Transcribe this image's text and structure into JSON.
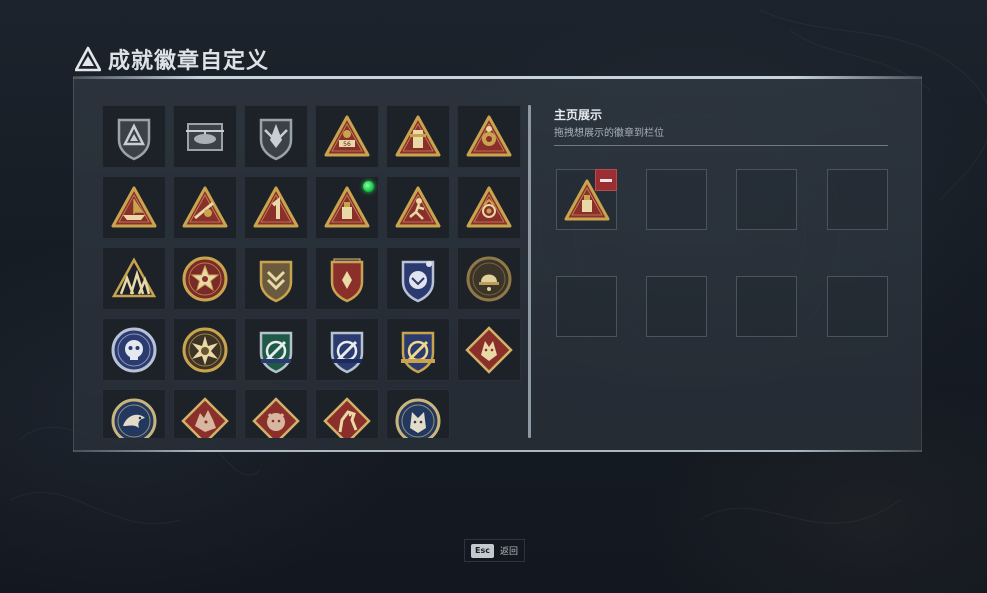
{
  "header": {
    "title": "成就徽章自定义",
    "logo_icon": "triangle-emblem-icon"
  },
  "badge_collection": {
    "badges": [
      {
        "icon": "silver-triangle-shield-icon",
        "new": false
      },
      {
        "icon": "helicopter-crest-icon",
        "new": false
      },
      {
        "icon": "wing-shield-icon",
        "new": false
      },
      {
        "icon": "tank-56-triangle-icon",
        "new": false
      },
      {
        "icon": "soldier-triangle-icon",
        "new": false
      },
      {
        "icon": "gear-triangle-icon",
        "new": false
      },
      {
        "icon": "boat-triangle-icon",
        "new": false
      },
      {
        "icon": "gunner-triangle-icon",
        "new": false
      },
      {
        "icon": "number-one-triangle-icon",
        "new": false
      },
      {
        "icon": "supply-triangle-icon",
        "new": true
      },
      {
        "icon": "runner-triangle-icon",
        "new": false
      },
      {
        "icon": "flower-triangle-icon",
        "new": false
      },
      {
        "icon": "squad-triangle-icon",
        "new": false
      },
      {
        "icon": "star-medal-icon",
        "new": false
      },
      {
        "icon": "chevron-shield-icon",
        "new": false
      },
      {
        "icon": "blue-star-shield-icon",
        "new": false
      },
      {
        "icon": "bird-shield-icon",
        "new": false
      },
      {
        "icon": "helmet-round-icon",
        "new": false
      },
      {
        "icon": "skull-round-icon",
        "new": false
      },
      {
        "icon": "burst-round-icon",
        "new": false
      },
      {
        "icon": "green-propeller-shield-icon",
        "new": false
      },
      {
        "icon": "blue-propeller-shield-icon",
        "new": false
      },
      {
        "icon": "gold-propeller-shield-icon",
        "new": false
      },
      {
        "icon": "wolf-diamond-icon",
        "new": false
      },
      {
        "icon": "eagle-round-icon",
        "new": false
      },
      {
        "icon": "dragon-diamond-icon",
        "new": false
      },
      {
        "icon": "tiger-diamond-icon",
        "new": false
      },
      {
        "icon": "horse-diamond-icon",
        "new": false
      },
      {
        "icon": "wolf-round-icon",
        "new": false
      }
    ]
  },
  "showcase": {
    "title": "主页展示",
    "subtitle": "拖拽想展示的徽章到栏位",
    "slots": [
      {
        "filled": true,
        "icon": "supply-triangle-icon",
        "remove_icon": "minus-icon"
      },
      {
        "filled": false
      },
      {
        "filled": false
      },
      {
        "filled": false
      },
      {
        "filled": false
      },
      {
        "filled": false
      },
      {
        "filled": false
      },
      {
        "filled": false
      }
    ]
  },
  "footer": {
    "key": "Esc",
    "label": "返回"
  },
  "colors": {
    "gold": "#c9a44e",
    "maroon": "#8b2f2b",
    "navy": "#2a3a6a",
    "remove_red": "#9a2e33",
    "new_dot": "#25e05a"
  }
}
